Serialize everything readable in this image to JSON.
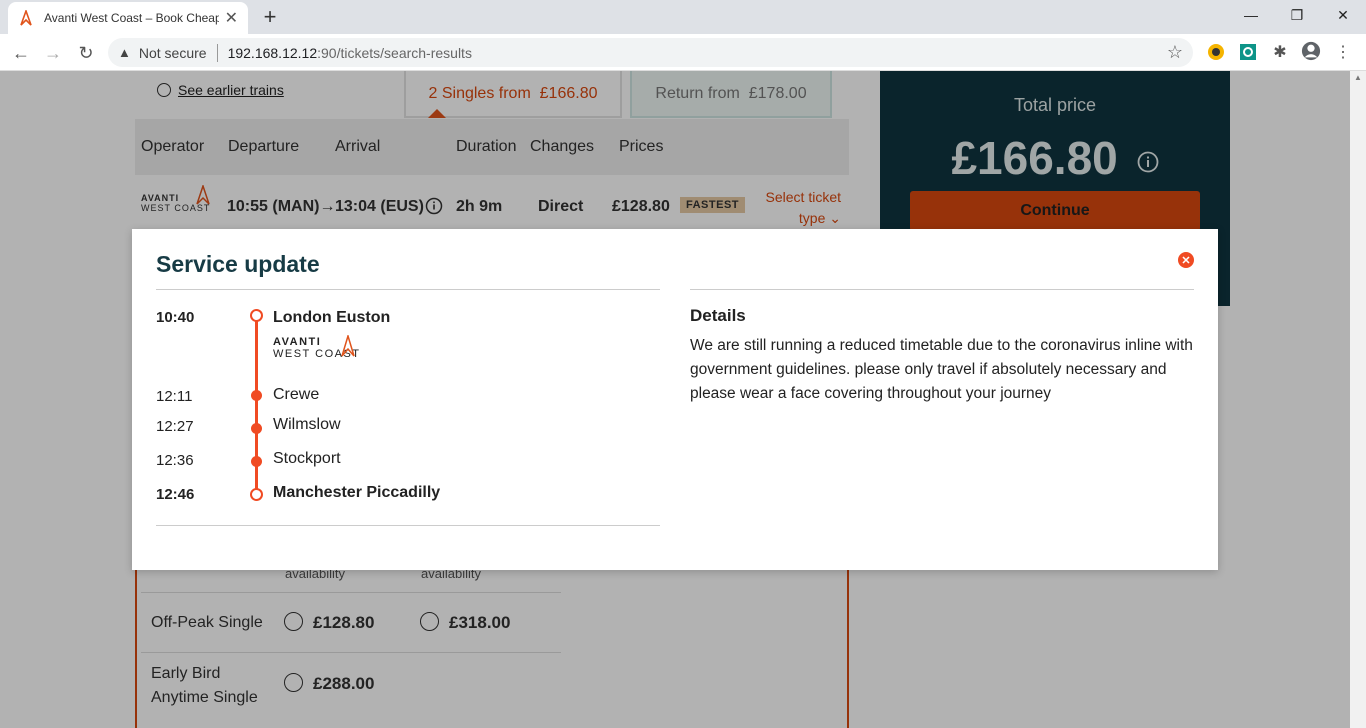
{
  "browser": {
    "tab_title": "Avanti West Coast – Book Cheap",
    "not_secure": "Not secure",
    "url_host": "192.168.12.12",
    "url_path": ":90/tickets/search-results"
  },
  "results": {
    "earlier_link": "See earlier trains",
    "singles_tab": "2 Singles from  £166.80",
    "return_tab": "Return from  £178.00",
    "headers": {
      "operator": "Operator",
      "departure": "Departure",
      "arrival": "Arrival",
      "duration": "Duration",
      "changes": "Changes",
      "prices": "Prices"
    },
    "row": {
      "logo_line1": "AVANTI",
      "logo_line2": "WEST COAST",
      "departure": "10:55 (MAN)→",
      "arrival": "13:04 (EUS)",
      "duration": "2h 9m",
      "changes": "Direct",
      "price": "£128.80",
      "badge": "FASTEST",
      "select_ticket": "Select ticket type"
    }
  },
  "total": {
    "label": "Total price",
    "price": "£166.80",
    "continue": "Continue"
  },
  "fares": {
    "availability_1": "availability",
    "availability_2": "availability",
    "rows": [
      {
        "name": "Off-Peak Single",
        "price_1": "£128.80",
        "price_2": "£318.00"
      },
      {
        "name_line1": "Early Bird",
        "name_line2": "Anytime Single",
        "price_1": "£288.00"
      }
    ]
  },
  "modal": {
    "title": "Service update",
    "operator_line1": "AVANTI",
    "operator_line2": "WEST COAST",
    "stops": [
      {
        "time": "10:40",
        "name": "London Euston"
      },
      {
        "time": "12:11",
        "name": "Crewe"
      },
      {
        "time": "12:27",
        "name": "Wilmslow"
      },
      {
        "time": "12:36",
        "name": "Stockport"
      },
      {
        "time": "12:46",
        "name": "Manchester Piccadilly"
      }
    ],
    "details_title": "Details",
    "details_text": "We are still running a reduced timetable due to the coronavirus inline with government guidelines. please only travel if absolutely necessary and please wear a face covering throughout your journey"
  },
  "colors": {
    "accent": "#f04b23",
    "brand_dark": "#0f3440"
  }
}
